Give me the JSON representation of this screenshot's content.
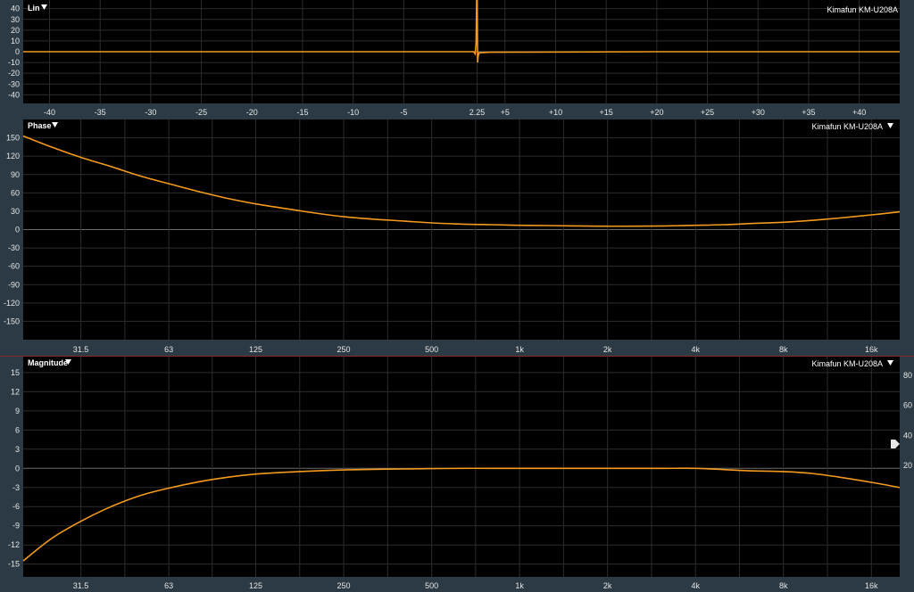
{
  "theme": {
    "background": "#2b3a44",
    "plot_background": "#000000",
    "curve_color": "#f59a1e",
    "separator_color": "#8a2b2b"
  },
  "panels": {
    "impulse": {
      "title": "Lin",
      "device": "Kimafun KM-U208A",
      "menu_icon": "dropdown-triangle-icon"
    },
    "phase": {
      "title": "Phase",
      "device": "Kimafun KM-U208A",
      "menu_icon": "dropdown-triangle-icon"
    },
    "magnitude": {
      "title": "Magnitude",
      "device": "Kimafun KM-U208A",
      "menu_icon": "dropdown-triangle-icon",
      "handle_icon": "slider-handle-icon"
    }
  },
  "chart_data": [
    {
      "type": "line",
      "panel": "impulse",
      "title": "Lin",
      "xlabel": "",
      "ylabel": "",
      "xlim": [
        -42.6,
        44.0
      ],
      "ylim": [
        -48,
        48
      ],
      "yticks": [
        -40,
        -30,
        -20,
        -10,
        0,
        10,
        20,
        30,
        40
      ],
      "xticks": [
        -40,
        -35,
        -30,
        -25,
        -20,
        -15,
        -10,
        -5,
        2.25,
        5,
        10,
        15,
        20,
        25,
        30,
        35,
        40
      ],
      "xtick_labels": [
        "-40",
        "-35",
        "-30",
        "-25",
        "-20",
        "-15",
        "-10",
        "-5",
        "2.25",
        "+5",
        "+10",
        "+15",
        "+20",
        "+25",
        "+30",
        "+35",
        "+40"
      ],
      "grid": true,
      "series": [
        {
          "name": "Kimafun KM-U208A",
          "x": [
            -42.6,
            -10,
            1.9,
            2.05,
            2.15,
            2.2,
            2.25,
            2.3,
            2.35,
            2.45,
            3.5,
            20,
            44.0
          ],
          "y": [
            0,
            0,
            0,
            -2,
            8,
            48,
            48,
            -10,
            -4,
            -1,
            -0.5,
            0,
            0
          ]
        }
      ]
    },
    {
      "type": "line",
      "panel": "phase",
      "title": "Phase",
      "xlabel": "",
      "ylabel": "",
      "x_scale": "log",
      "xlim": [
        20,
        20000
      ],
      "ylim": [
        -180,
        180
      ],
      "yticks": [
        -150,
        -120,
        -90,
        -60,
        -30,
        0,
        30,
        60,
        90,
        120,
        150
      ],
      "xticks": [
        31.5,
        63,
        125,
        250,
        500,
        1000,
        2000,
        4000,
        8000,
        16000
      ],
      "xtick_labels": [
        "31.5",
        "63",
        "125",
        "250",
        "500",
        "1k",
        "2k",
        "4k",
        "8k",
        "16k"
      ],
      "grid": true,
      "series": [
        {
          "name": "Kimafun KM-U208A",
          "x": [
            20,
            25,
            31.5,
            40,
            50,
            63,
            80,
            100,
            125,
            160,
            200,
            250,
            315,
            400,
            500,
            630,
            800,
            1000,
            1250,
            1600,
            2000,
            2500,
            3150,
            4000,
            5000,
            6300,
            8000,
            10000,
            12500,
            16000,
            20000
          ],
          "y": [
            153,
            135,
            118,
            103,
            88,
            75,
            62,
            51,
            42,
            34,
            27,
            21,
            17,
            14,
            11,
            9,
            8,
            7,
            6.5,
            6,
            5.5,
            5.5,
            6,
            7,
            8,
            10,
            12,
            15,
            19,
            24,
            29
          ]
        }
      ]
    },
    {
      "type": "line",
      "panel": "magnitude",
      "title": "Magnitude",
      "xlabel": "",
      "ylabel": "",
      "x_scale": "log",
      "xlim": [
        20,
        20000
      ],
      "ylim": [
        -17,
        17.5
      ],
      "yticks": [
        -15,
        -12,
        -9,
        -6,
        -3,
        0,
        3,
        6,
        9,
        12,
        15
      ],
      "y2ticks": [
        20,
        40,
        60,
        80
      ],
      "xticks": [
        31.5,
        63,
        125,
        250,
        500,
        1000,
        2000,
        4000,
        8000,
        16000
      ],
      "xtick_labels": [
        "31.5",
        "63",
        "125",
        "250",
        "500",
        "1k",
        "2k",
        "4k",
        "8k",
        "16k"
      ],
      "grid": true,
      "series": [
        {
          "name": "Kimafun KM-U208A",
          "x": [
            20,
            25,
            31.5,
            40,
            50,
            63,
            80,
            100,
            125,
            160,
            200,
            250,
            315,
            400,
            500,
            630,
            800,
            1000,
            1250,
            1600,
            2000,
            2500,
            3150,
            4000,
            5000,
            6300,
            8000,
            10000,
            12500,
            16000,
            20000
          ],
          "y": [
            -14.5,
            -11,
            -8.3,
            -6,
            -4.3,
            -3.1,
            -2.1,
            -1.4,
            -0.9,
            -0.6,
            -0.4,
            -0.25,
            -0.15,
            -0.1,
            -0.05,
            0,
            0,
            0,
            0,
            0,
            0,
            0,
            0,
            0,
            -0.2,
            -0.4,
            -0.5,
            -0.8,
            -1.4,
            -2.2,
            -3.0
          ]
        }
      ]
    }
  ]
}
